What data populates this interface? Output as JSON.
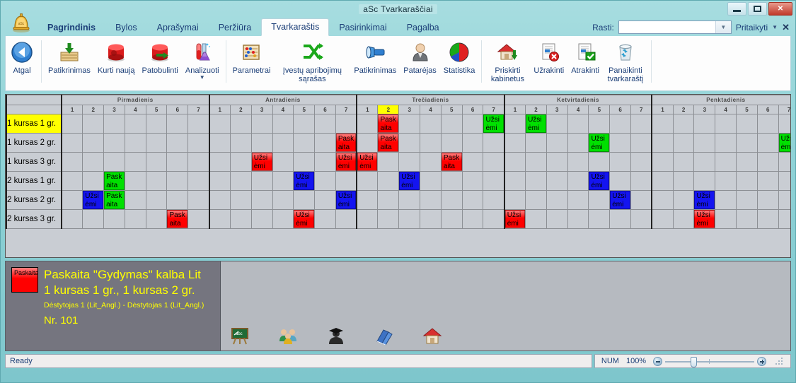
{
  "window": {
    "title": "aSc Tvarkaraščiai",
    "controls": {
      "minimize": "minimize-button",
      "maximize": "maximize-button",
      "close": "✕"
    }
  },
  "ribbon": {
    "tabs": [
      {
        "label": "Pagrindinis",
        "active": false,
        "bold": true
      },
      {
        "label": "Bylos",
        "active": false,
        "bold": false
      },
      {
        "label": "Aprašymai",
        "active": false,
        "bold": false
      },
      {
        "label": "Peržiūra",
        "active": false,
        "bold": false
      },
      {
        "label": "Tvarkaraštis",
        "active": true,
        "bold": false
      },
      {
        "label": "Pasirinkimai",
        "active": false,
        "bold": false
      },
      {
        "label": "Pagalba",
        "active": false,
        "bold": false
      }
    ],
    "find_label": "Rasti:",
    "find_value": "",
    "find_placeholder": "",
    "customize_label": "Pritaikyti",
    "close_label": "✕",
    "buttons": [
      {
        "label": "Atgal",
        "icon": "back-arrow-icon",
        "caret": false
      },
      {
        "label": "Patikrinimas",
        "icon": "import-box-icon",
        "caret": false
      },
      {
        "label": "Kurti naują",
        "icon": "red-cylinder-icon",
        "caret": false
      },
      {
        "label": "Patobulinti",
        "icon": "red-cylinder-arrow-icon",
        "caret": false
      },
      {
        "label": "Analizuoti",
        "icon": "test-tubes-icon",
        "caret": true
      },
      {
        "label": "Parametrai",
        "icon": "abacus-icon",
        "caret": false
      },
      {
        "label": "Įvestų apribojimų sąrašas",
        "icon": "shuffle-icon",
        "caret": false
      },
      {
        "label": "Patikrinimas",
        "icon": "flashlight-icon",
        "caret": false
      },
      {
        "label": "Patarėjas",
        "icon": "advisor-person-icon",
        "caret": false
      },
      {
        "label": "Statistika",
        "icon": "pie-chart-icon",
        "caret": false
      },
      {
        "label": "Priskirti kabinetus",
        "icon": "house-arrow-icon",
        "caret": false
      },
      {
        "label": "Užrakinti",
        "icon": "document-lock-red-icon",
        "caret": false
      },
      {
        "label": "Atrakinti",
        "icon": "document-check-green-icon",
        "caret": false
      },
      {
        "label": "Panaikinti tvarkaraštį",
        "icon": "recycle-bin-icon",
        "caret": false
      }
    ],
    "group_separators_after": [
      0,
      4,
      9,
      13
    ]
  },
  "timetable": {
    "days": [
      "Pirmadienis",
      "Antradienis",
      "Trečiadienis",
      "Ketvirtadienis",
      "Penktadienis"
    ],
    "periods": [
      "1",
      "2",
      "3",
      "4",
      "5",
      "6",
      "7"
    ],
    "selected_period": {
      "day": 2,
      "period": 1
    },
    "rows": [
      "1 kursas 1 gr.",
      "1 kursas 2 gr.",
      "1 kursas 3 gr.",
      "2 kursas 1 gr.",
      "2 kursas 2 gr.",
      "2 kursas 3 gr."
    ],
    "selected_row": 0,
    "events": [
      {
        "row": 0,
        "day": 2,
        "period": 1,
        "text": "Paskaita \"Gydymas\"",
        "color": "red"
      },
      {
        "row": 0,
        "day": 2,
        "period": 6,
        "text": "Užsiėmima",
        "color": "green"
      },
      {
        "row": 0,
        "day": 3,
        "period": 1,
        "text": "Užsiėmima",
        "color": "green"
      },
      {
        "row": 1,
        "day": 1,
        "period": 6,
        "text": "Paskaita \"Gydymas\"",
        "color": "red"
      },
      {
        "row": 1,
        "day": 2,
        "period": 1,
        "text": "Paskaita \"Gydymas\"",
        "color": "red"
      },
      {
        "row": 1,
        "day": 3,
        "period": 4,
        "text": "Užsiėmima",
        "color": "green"
      },
      {
        "row": 1,
        "day": 4,
        "period": 6,
        "text": "Užsiėmima",
        "color": "green"
      },
      {
        "row": 2,
        "day": 1,
        "period": 2,
        "text": "Užsiėmima",
        "color": "red"
      },
      {
        "row": 2,
        "day": 1,
        "period": 6,
        "text": "Užsiėmima",
        "color": "red"
      },
      {
        "row": 2,
        "day": 2,
        "period": 0,
        "text": "Užsiėmima",
        "color": "red"
      },
      {
        "row": 2,
        "day": 2,
        "period": 4,
        "text": "Paskaita \"Gydymas\"",
        "color": "red"
      },
      {
        "row": 3,
        "day": 0,
        "period": 2,
        "text": "Paskaita",
        "color": "green"
      },
      {
        "row": 3,
        "day": 1,
        "period": 4,
        "text": "Užsiėmima",
        "color": "blue"
      },
      {
        "row": 3,
        "day": 2,
        "period": 2,
        "text": "Užsiėmima",
        "color": "blue"
      },
      {
        "row": 3,
        "day": 3,
        "period": 4,
        "text": "Užsiėmima",
        "color": "blue"
      },
      {
        "row": 4,
        "day": 0,
        "period": 1,
        "text": "Užsiėmima",
        "color": "blue"
      },
      {
        "row": 4,
        "day": 0,
        "period": 2,
        "text": "Paskaita",
        "color": "green"
      },
      {
        "row": 4,
        "day": 1,
        "period": 6,
        "text": "Užsiėmima",
        "color": "blue"
      },
      {
        "row": 4,
        "day": 3,
        "period": 5,
        "text": "Užsiėmima",
        "color": "blue"
      },
      {
        "row": 4,
        "day": 4,
        "period": 2,
        "text": "Užsiėmima",
        "color": "blue"
      },
      {
        "row": 5,
        "day": 0,
        "period": 5,
        "text": "Paskaita \"Anatomija\"",
        "color": "red"
      },
      {
        "row": 5,
        "day": 1,
        "period": 4,
        "text": "Užsiėmima",
        "color": "red"
      },
      {
        "row": 5,
        "day": 3,
        "period": 0,
        "text": "Užsiėmima",
        "color": "red"
      },
      {
        "row": 5,
        "day": 4,
        "period": 2,
        "text": "Užsiėmima",
        "color": "red"
      }
    ]
  },
  "detail": {
    "chip_text": "Paskaita",
    "line1": "Paskaita \"Gydymas\" kalba Lit",
    "line2": "1 kursas 1 gr., 1 kursas 2 gr.",
    "line3": "Dėstytojas 1 (Lit_Angl.) - Dėstytojas 1 (Lit_Angl.)",
    "line4": "Nr. 101",
    "icons": [
      {
        "name": "blackboard-icon"
      },
      {
        "name": "people-group-icon"
      },
      {
        "name": "graduate-icon"
      },
      {
        "name": "book-icon"
      },
      {
        "name": "house-icon"
      }
    ]
  },
  "statusbar": {
    "ready": "Ready",
    "num": "NUM",
    "zoom": "100%",
    "zoom_out": "zoom-out-button",
    "zoom_in": "zoom-in-button"
  },
  "colors": {
    "red": "#ff0000",
    "green": "#00e000",
    "blue": "#1414f0",
    "selection": "#ffff00",
    "accent": "#7fc9cf"
  }
}
